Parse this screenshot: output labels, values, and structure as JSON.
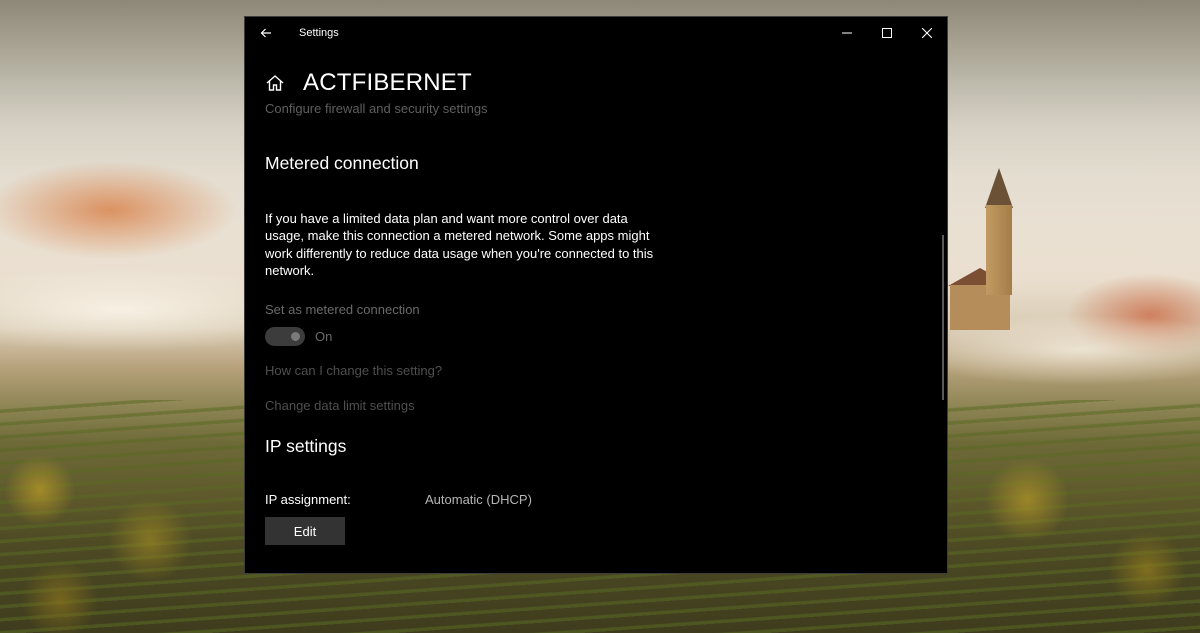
{
  "window": {
    "app_title": "Settings",
    "back_icon": "back-arrow-icon",
    "minimize_icon": "minimize-icon",
    "maximize_icon": "maximize-icon",
    "close_icon": "close-icon"
  },
  "header": {
    "home_icon": "home-icon",
    "title": "ACTFIBERNET",
    "subtitle": "Configure firewall and security settings"
  },
  "metered": {
    "heading": "Metered connection",
    "description": "If you have a limited data plan and want more control over data usage, make this connection a metered network. Some apps might work differently to reduce data usage when you're connected to this network.",
    "toggle_label": "Set as metered connection",
    "toggle_state": "On",
    "toggle_on": true,
    "help_link": "How can I change this setting?",
    "data_limit_link": "Change data limit settings"
  },
  "ip": {
    "heading": "IP settings",
    "assignment_label": "IP assignment:",
    "assignment_value": "Automatic (DHCP)",
    "edit_label": "Edit"
  },
  "colors": {
    "window_bg": "#000000",
    "text": "#ffffff",
    "dim_text": "#5f5f5f",
    "button_bg": "#333333"
  }
}
